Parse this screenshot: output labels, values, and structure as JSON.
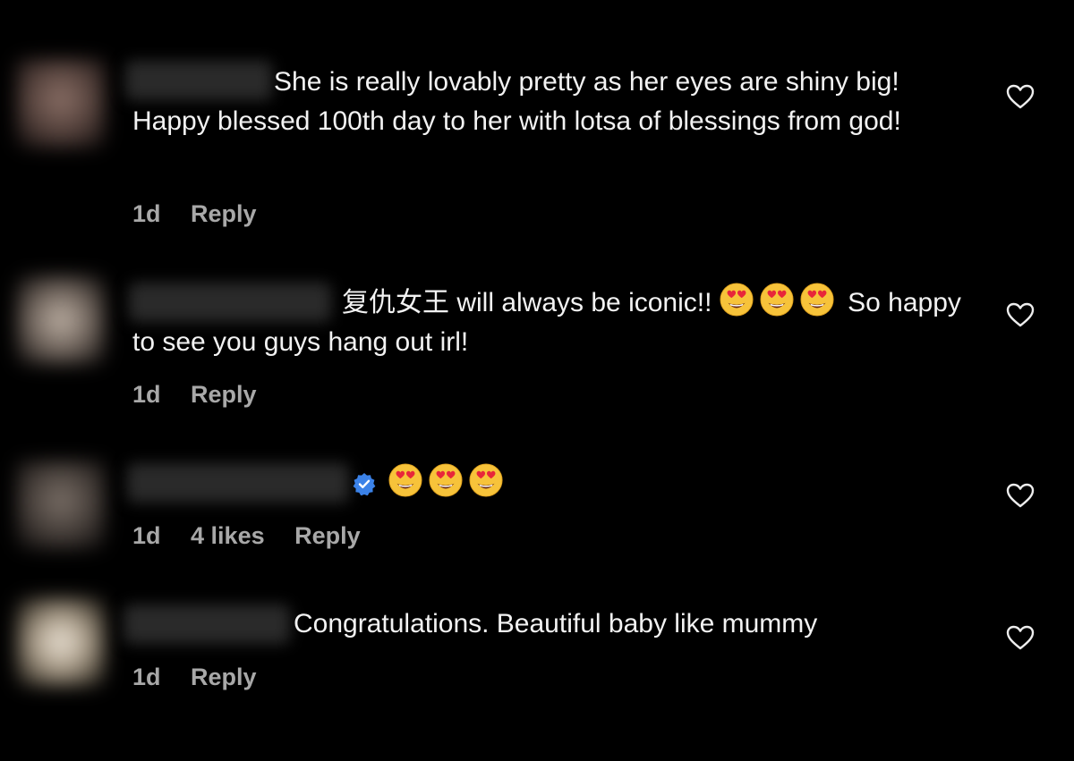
{
  "colors": {
    "background": "#000000",
    "text": "#f2f2f2",
    "meta": "#a8a8a8",
    "verified": "#3897f0"
  },
  "comments": [
    {
      "text": "She is really lovably pretty as her eyes are shiny big! Happy blessed 100th day to her with lotsa of blessings from god!",
      "time": "1d",
      "likes": "",
      "reply": "Reply"
    },
    {
      "text_before": "复仇女王 will always be iconic!! ",
      "emojis": [
        "heart-eyes-emoji",
        "heart-eyes-emoji",
        "heart-eyes-emoji"
      ],
      "text_after": " So happy to see you guys hang out irl!",
      "time": "1d",
      "likes": "",
      "reply": "Reply"
    },
    {
      "verified": true,
      "emojis": [
        "heart-eyes-emoji",
        "heart-eyes-emoji",
        "heart-eyes-emoji"
      ],
      "time": "1d",
      "likes": "4 likes",
      "reply": "Reply"
    },
    {
      "text": "Congratulations. Beautiful baby like mummy",
      "time": "1d",
      "likes": "",
      "reply": "Reply"
    }
  ]
}
